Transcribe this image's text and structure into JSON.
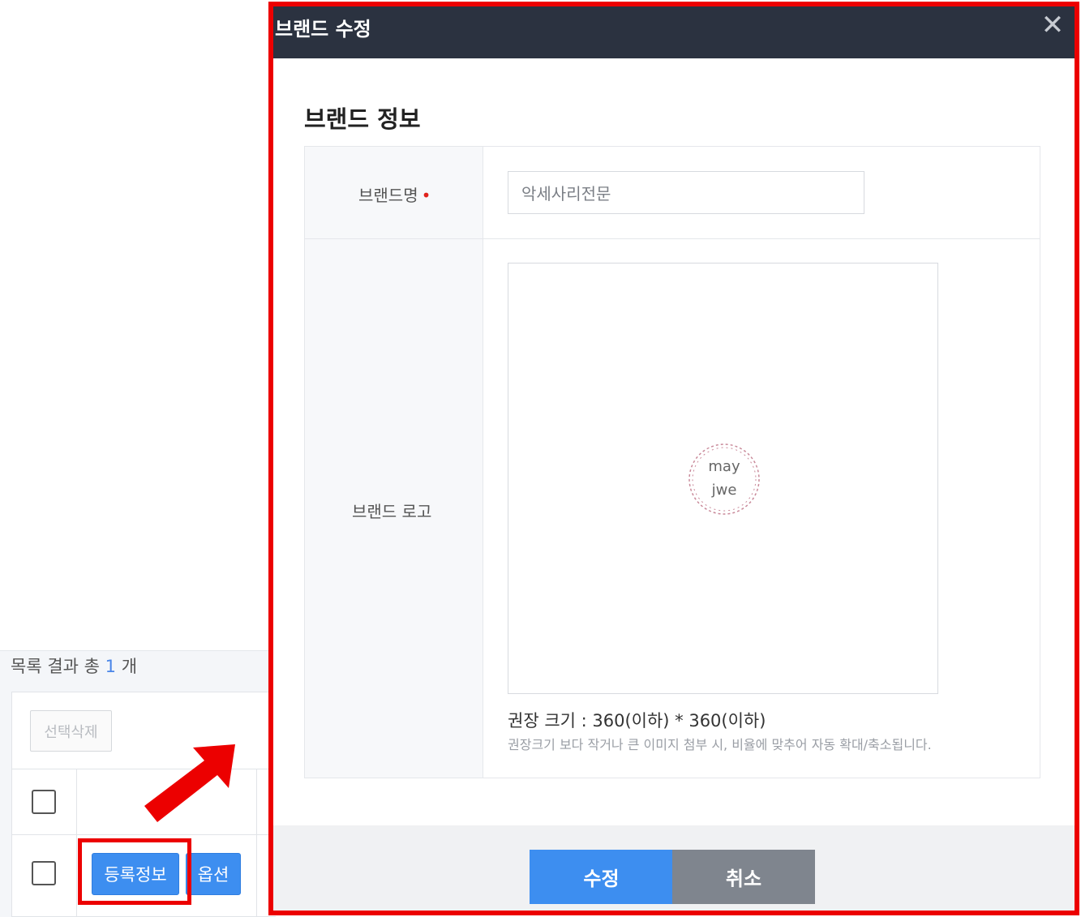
{
  "list": {
    "summary_prefix": "목록 결과 총",
    "summary_count": "1",
    "summary_suffix": "개",
    "delete_selected_label": "선택삭제",
    "register_info_label": "등록정보",
    "option_label": "옵션"
  },
  "modal": {
    "title": "브랜드 수정",
    "close_icon": "close-icon",
    "section_title": "브랜드 정보",
    "brand_name_label": "브랜드명",
    "required_mark": "•",
    "brand_name_value": "악세사리전문",
    "brand_logo_label": "브랜드 로고",
    "logo_text_line1": "may",
    "logo_text_line2": "jwe",
    "recommended_size": "권장 크기 : 360(이하) * 360(이하)",
    "size_notice": "권장크기 보다 작거나 큰 이미지 첨부 시, 비율에 맞추어 자동 확대/축소됩니다.",
    "submit_label": "수정",
    "cancel_label": "취소"
  },
  "colors": {
    "header_bg": "#2b3240",
    "primary": "#3d8ef0",
    "secondary": "#7f858e",
    "highlight": "#ec0000"
  }
}
